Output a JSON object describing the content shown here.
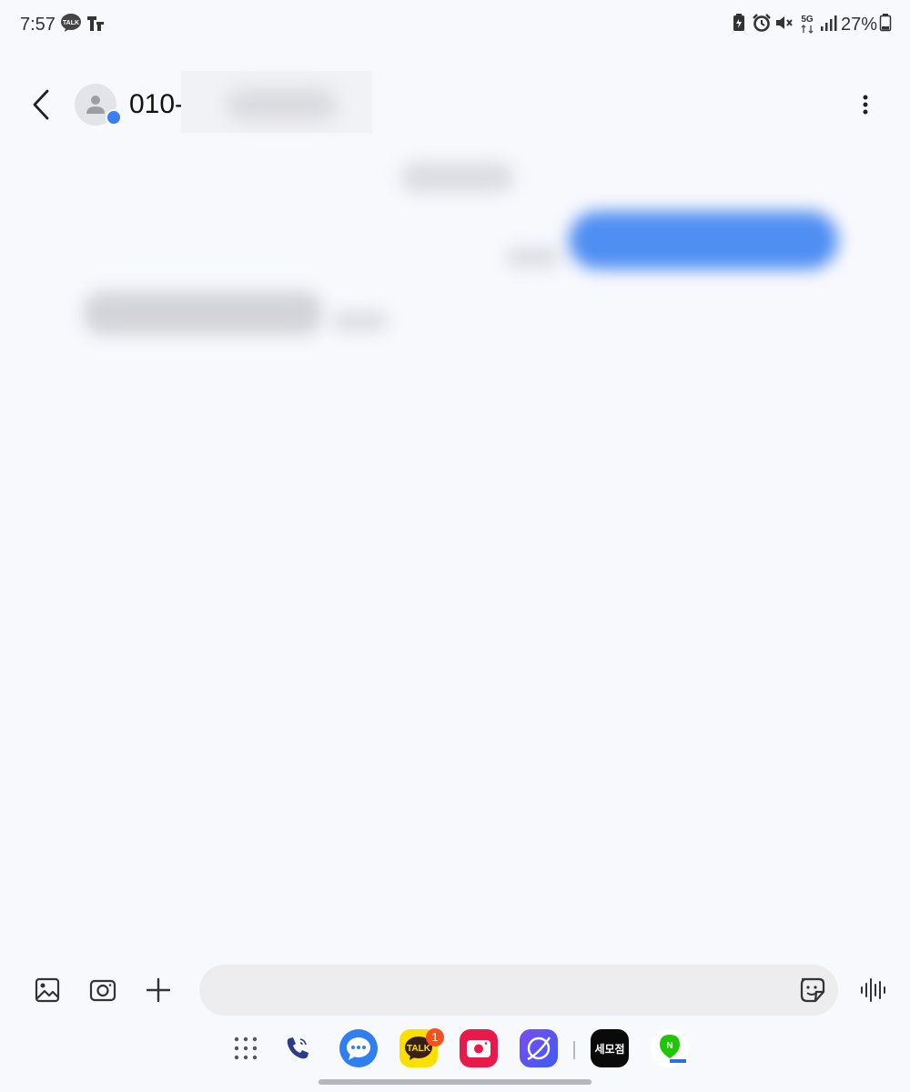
{
  "status_bar": {
    "time": "7:57",
    "battery_percent": "27%",
    "network": "5G",
    "left_icons": [
      "kakaotalk-icon",
      "app-notification-icon"
    ],
    "right_icons": [
      "battery-saver-icon",
      "alarm-icon",
      "mute-icon",
      "5g-icon",
      "signal-icon",
      "battery-icon"
    ]
  },
  "header": {
    "contact_prefix": "010-",
    "back_icon": "chevron-left-icon",
    "more_icon": "more-vertical-icon"
  },
  "input_bar": {
    "message_value": "",
    "message_placeholder": "",
    "buttons": [
      "gallery-icon",
      "camera-icon",
      "plus-icon",
      "sticker-icon",
      "voice-icon"
    ]
  },
  "dock": {
    "kakao_label": "TALK",
    "kakao_badge": "1",
    "news_label": "세모점",
    "naver_label": "N",
    "apps": [
      "apps-grid-icon",
      "phone-icon",
      "messages-icon",
      "kakaotalk-icon",
      "camera-app-icon",
      "internet-icon",
      "semojeom-icon",
      "naver-icon"
    ]
  },
  "colors": {
    "accent_blue": "#3a7ff0",
    "background": "#f8f9fd",
    "input_background": "#ededf0",
    "kakao_yellow": "#f9e000",
    "badge_orange": "#f4511e"
  }
}
